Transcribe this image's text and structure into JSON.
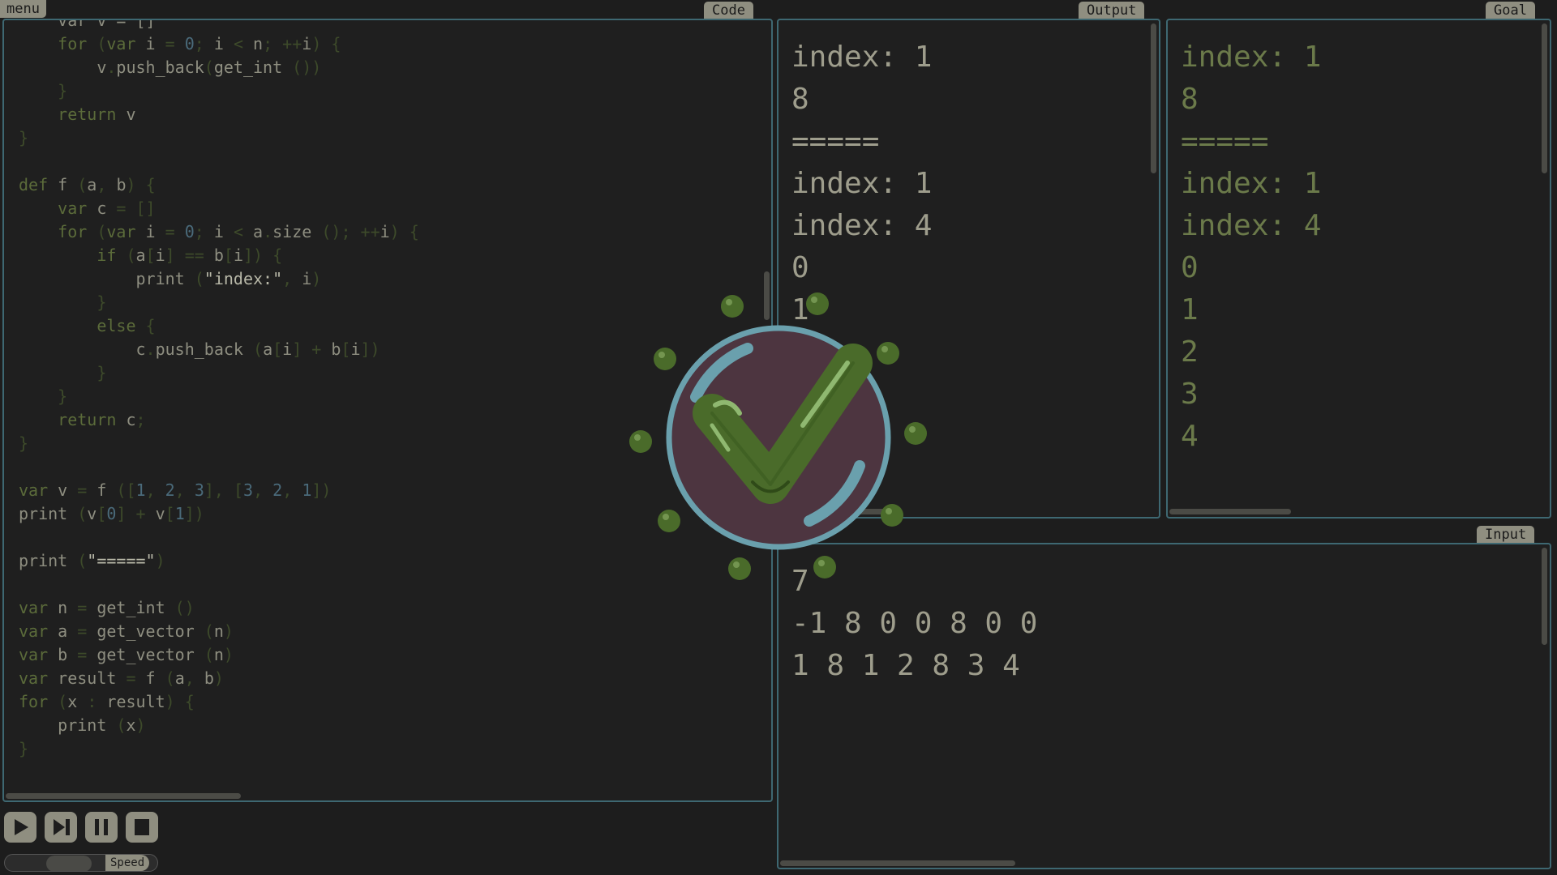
{
  "menu": {
    "label": "menu"
  },
  "code_panel": {
    "title": "Code",
    "lines": [
      [
        [
          "plain",
          "    var v = []"
        ]
      ],
      [
        [
          "kw",
          "    for "
        ],
        [
          "punct",
          "("
        ],
        [
          "kw",
          "var"
        ],
        [
          "plain",
          " i "
        ],
        [
          "punct",
          "= "
        ],
        [
          "num",
          "0"
        ],
        [
          "punct",
          "; "
        ],
        [
          "plain",
          "i "
        ],
        [
          "punct",
          "< "
        ],
        [
          "plain",
          "n"
        ],
        [
          "punct",
          "; ++"
        ],
        [
          "plain",
          "i"
        ],
        [
          "punct",
          ") {"
        ]
      ],
      [
        [
          "plain",
          "        v"
        ],
        [
          "punct",
          "."
        ],
        [
          "plain",
          "push_back"
        ],
        [
          "punct",
          "("
        ],
        [
          "plain",
          "get_int "
        ],
        [
          "punct",
          "())"
        ]
      ],
      [
        [
          "punct",
          "    }"
        ]
      ],
      [
        [
          "kw",
          "    return"
        ],
        [
          "plain",
          " v"
        ]
      ],
      [
        [
          "punct",
          "}"
        ]
      ],
      [
        [
          "plain",
          ""
        ]
      ],
      [
        [
          "kw",
          "def"
        ],
        [
          "plain",
          " f "
        ],
        [
          "punct",
          "("
        ],
        [
          "plain",
          "a"
        ],
        [
          "punct",
          ", "
        ],
        [
          "plain",
          "b"
        ],
        [
          "punct",
          ") {"
        ]
      ],
      [
        [
          "kw",
          "    var"
        ],
        [
          "plain",
          " c "
        ],
        [
          "punct",
          "= []"
        ]
      ],
      [
        [
          "kw",
          "    for "
        ],
        [
          "punct",
          "("
        ],
        [
          "kw",
          "var"
        ],
        [
          "plain",
          " i "
        ],
        [
          "punct",
          "= "
        ],
        [
          "num",
          "0"
        ],
        [
          "punct",
          "; "
        ],
        [
          "plain",
          "i "
        ],
        [
          "punct",
          "< "
        ],
        [
          "plain",
          "a"
        ],
        [
          "punct",
          "."
        ],
        [
          "plain",
          "size "
        ],
        [
          "punct",
          "(); ++"
        ],
        [
          "plain",
          "i"
        ],
        [
          "punct",
          ") {"
        ]
      ],
      [
        [
          "kw",
          "        if "
        ],
        [
          "punct",
          "("
        ],
        [
          "plain",
          "a"
        ],
        [
          "punct",
          "["
        ],
        [
          "plain",
          "i"
        ],
        [
          "punct",
          "] == "
        ],
        [
          "plain",
          "b"
        ],
        [
          "punct",
          "["
        ],
        [
          "plain",
          "i"
        ],
        [
          "punct",
          "]) {"
        ]
      ],
      [
        [
          "plain",
          "            print "
        ],
        [
          "punct",
          "("
        ],
        [
          "str",
          "\"index:\""
        ],
        [
          "punct",
          ", "
        ],
        [
          "plain",
          "i"
        ],
        [
          "punct",
          ")"
        ]
      ],
      [
        [
          "punct",
          "        }"
        ]
      ],
      [
        [
          "kw",
          "        else"
        ],
        [
          "punct",
          " {"
        ]
      ],
      [
        [
          "plain",
          "            c"
        ],
        [
          "punct",
          "."
        ],
        [
          "plain",
          "push_back "
        ],
        [
          "punct",
          "("
        ],
        [
          "plain",
          "a"
        ],
        [
          "punct",
          "["
        ],
        [
          "plain",
          "i"
        ],
        [
          "punct",
          "] + "
        ],
        [
          "plain",
          "b"
        ],
        [
          "punct",
          "["
        ],
        [
          "plain",
          "i"
        ],
        [
          "punct",
          "])"
        ]
      ],
      [
        [
          "punct",
          "        }"
        ]
      ],
      [
        [
          "punct",
          "    }"
        ]
      ],
      [
        [
          "kw",
          "    return"
        ],
        [
          "plain",
          " c"
        ],
        [
          "punct",
          ";"
        ]
      ],
      [
        [
          "punct",
          "}"
        ]
      ],
      [
        [
          "plain",
          ""
        ]
      ],
      [
        [
          "kw",
          "var"
        ],
        [
          "plain",
          " v "
        ],
        [
          "punct",
          "= "
        ],
        [
          "plain",
          "f "
        ],
        [
          "punct",
          "(["
        ],
        [
          "num",
          "1"
        ],
        [
          "punct",
          ", "
        ],
        [
          "num",
          "2"
        ],
        [
          "punct",
          ", "
        ],
        [
          "num",
          "3"
        ],
        [
          "punct",
          "], ["
        ],
        [
          "num",
          "3"
        ],
        [
          "punct",
          ", "
        ],
        [
          "num",
          "2"
        ],
        [
          "punct",
          ", "
        ],
        [
          "num",
          "1"
        ],
        [
          "punct",
          "])"
        ]
      ],
      [
        [
          "plain",
          "print "
        ],
        [
          "punct",
          "("
        ],
        [
          "plain",
          "v"
        ],
        [
          "punct",
          "["
        ],
        [
          "num",
          "0"
        ],
        [
          "punct",
          "] + "
        ],
        [
          "plain",
          "v"
        ],
        [
          "punct",
          "["
        ],
        [
          "num",
          "1"
        ],
        [
          "punct",
          "])"
        ]
      ],
      [
        [
          "plain",
          ""
        ]
      ],
      [
        [
          "plain",
          "print "
        ],
        [
          "punct",
          "("
        ],
        [
          "str",
          "\"=====\""
        ],
        [
          "punct",
          ")"
        ]
      ],
      [
        [
          "plain",
          ""
        ]
      ],
      [
        [
          "kw",
          "var"
        ],
        [
          "plain",
          " n "
        ],
        [
          "punct",
          "= "
        ],
        [
          "plain",
          "get_int "
        ],
        [
          "punct",
          "()"
        ]
      ],
      [
        [
          "kw",
          "var"
        ],
        [
          "plain",
          " a "
        ],
        [
          "punct",
          "= "
        ],
        [
          "plain",
          "get_vector "
        ],
        [
          "punct",
          "("
        ],
        [
          "plain",
          "n"
        ],
        [
          "punct",
          ")"
        ]
      ],
      [
        [
          "kw",
          "var"
        ],
        [
          "plain",
          " b "
        ],
        [
          "punct",
          "= "
        ],
        [
          "plain",
          "get_vector "
        ],
        [
          "punct",
          "("
        ],
        [
          "plain",
          "n"
        ],
        [
          "punct",
          ")"
        ]
      ],
      [
        [
          "kw",
          "var"
        ],
        [
          "plain",
          " result "
        ],
        [
          "punct",
          "= "
        ],
        [
          "plain",
          "f "
        ],
        [
          "punct",
          "("
        ],
        [
          "plain",
          "a"
        ],
        [
          "punct",
          ", "
        ],
        [
          "plain",
          "b"
        ],
        [
          "punct",
          ")"
        ]
      ],
      [
        [
          "kw",
          "for "
        ],
        [
          "punct",
          "("
        ],
        [
          "plain",
          "x "
        ],
        [
          "punct",
          ": "
        ],
        [
          "plain",
          "result"
        ],
        [
          "punct",
          ") {"
        ]
      ],
      [
        [
          "plain",
          "    print "
        ],
        [
          "punct",
          "("
        ],
        [
          "plain",
          "x"
        ],
        [
          "punct",
          ")"
        ]
      ],
      [
        [
          "punct",
          "}"
        ]
      ]
    ]
  },
  "output_panel": {
    "title": "Output",
    "lines": [
      "index: 1",
      "8",
      "=====",
      "index: 1",
      "index: 4",
      "0",
      "1"
    ]
  },
  "goal_panel": {
    "title": "Goal",
    "lines": [
      "index: 1",
      "8",
      "=====",
      "index: 1",
      "index: 4",
      "0",
      "1",
      "2",
      "3",
      "4"
    ]
  },
  "input_panel": {
    "title": "Input",
    "lines": [
      "7",
      "-1 8 0 0 8 0 0",
      "1 8 1 2 8 3 4"
    ]
  },
  "controls": {
    "play_icon": "play-icon",
    "step_icon": "step-forward-icon",
    "pause_icon": "pause-icon",
    "stop_icon": "stop-icon",
    "speed_label": "Speed",
    "speed_level": 0.45
  },
  "overlay": {
    "icon": "success-checkmark-icon"
  },
  "colors": {
    "background": "#1d1d1d",
    "panel_border": "#3e6872",
    "tab": "#8f8e80",
    "check_green": "#4a6b2a",
    "badge_fill": "#4d3540",
    "badge_ring": "#6aa0ad"
  }
}
